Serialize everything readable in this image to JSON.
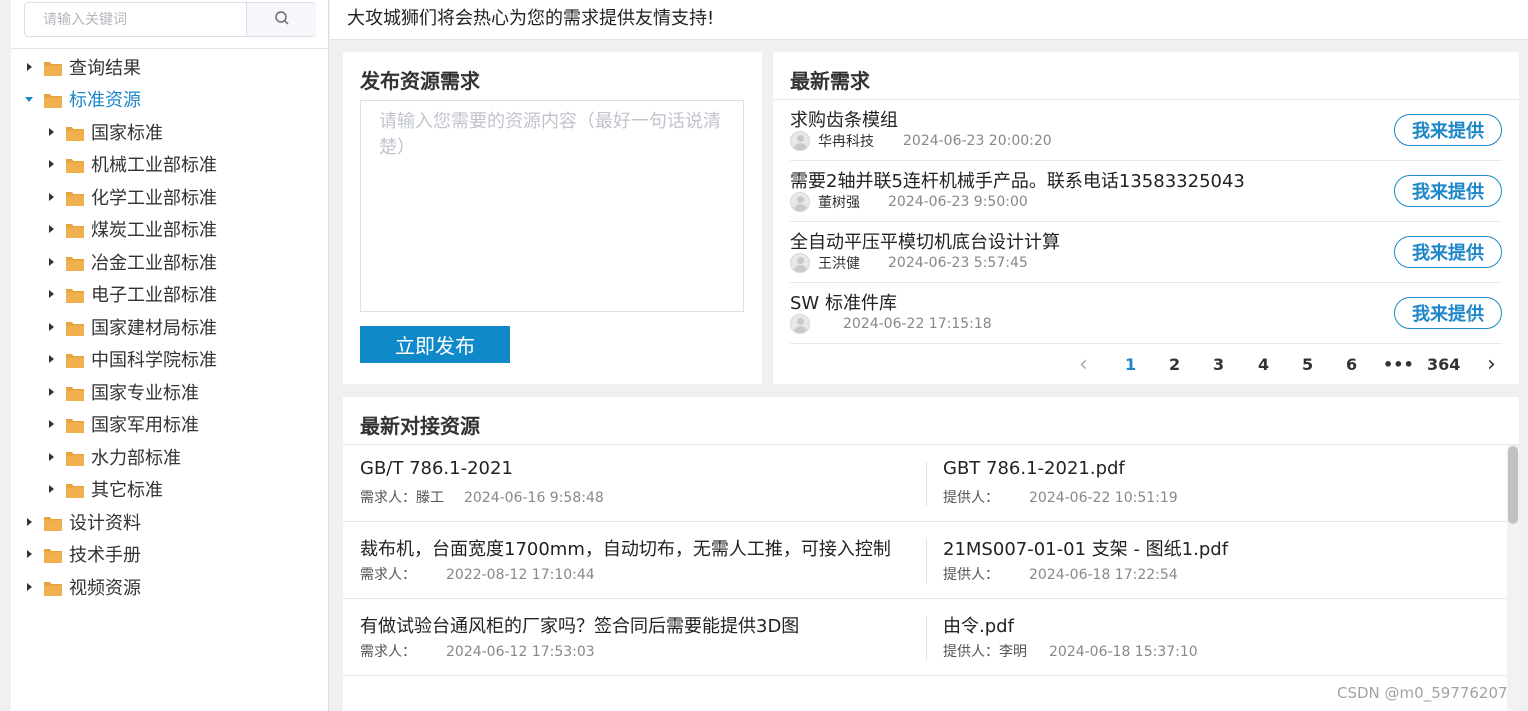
{
  "search": {
    "placeholder": "请输入关键词"
  },
  "tree": [
    {
      "label": "查询结果",
      "active": false
    },
    {
      "label": "标准资源",
      "active": true
    },
    {
      "label": "国家标准"
    },
    {
      "label": "机械工业部标准"
    },
    {
      "label": "化学工业部标准"
    },
    {
      "label": "煤炭工业部标准"
    },
    {
      "label": "冶金工业部标准"
    },
    {
      "label": "电子工业部标准"
    },
    {
      "label": "国家建材局标准"
    },
    {
      "label": "中国科学院标准"
    },
    {
      "label": "国家专业标准"
    },
    {
      "label": "国家军用标准"
    },
    {
      "label": "水力部标准"
    },
    {
      "label": "其它标准"
    },
    {
      "label": "设计资料"
    },
    {
      "label": "技术手册"
    },
    {
      "label": "视频资源"
    }
  ],
  "topbar": {
    "text": "大攻城狮们将会热心为您的需求提供友情支持!"
  },
  "publish": {
    "title": "发布资源需求",
    "placeholder": "请输入您需要的资源内容（最好一句话说清楚）",
    "button": "立即发布"
  },
  "latest_demands": {
    "title": "最新需求",
    "offer_label": "我来提供",
    "items": [
      {
        "title": "求购齿条模组",
        "user": "华冉科技",
        "date": "2024-06-23 20:00:20"
      },
      {
        "title": "需要2轴并联5连杆机械手产品。联系电话13583325043",
        "user": "董树强",
        "date": "2024-06-23 9:50:00"
      },
      {
        "title": "全自动平压平模切机底台设计计算",
        "user": "王洪健",
        "date": "2024-06-23 5:57:45"
      },
      {
        "title": "SW 标准件库",
        "user": "",
        "date": "2024-06-22 17:15:18"
      }
    ],
    "pagination": {
      "prev": "‹",
      "pages": [
        "1",
        "2",
        "3",
        "4",
        "5",
        "6",
        "•••",
        "364"
      ],
      "current": "1",
      "next": "›"
    }
  },
  "resources": {
    "title": "最新对接资源",
    "demand_prefix": "需求人：",
    "provider_prefix": "提供人：",
    "rows": [
      {
        "demand_title": "GB/T 786.1-2021",
        "demand_user": "滕工",
        "demand_date": "2024-06-16 9:58:48",
        "provide_title": "GBT 786.1-2021.pdf",
        "provide_user": "",
        "provide_date": "2024-06-22 10:51:19"
      },
      {
        "demand_title": "裁布机，台面宽度1700mm，自动切布，无需人工推，可接入控制",
        "demand_user": "",
        "demand_date": "2022-08-12 17:10:44",
        "provide_title": "21MS007-01-01 支架 - 图纸1.pdf",
        "provide_user": "",
        "provide_date": "2024-06-18 17:22:54"
      },
      {
        "demand_title": "有做试验台通风柜的厂家吗？签合同后需要能提供3D图",
        "demand_user": "",
        "demand_date": "2024-06-12 17:53:03",
        "provide_title": "由令.pdf",
        "provide_user": "李明",
        "provide_date": "2024-06-18 15:37:10"
      }
    ]
  },
  "watermark": "CSDN @m0_59776207",
  "colors": {
    "accent": "#1e87c9",
    "button": "#1089c9",
    "folder": "#e8a33d"
  }
}
